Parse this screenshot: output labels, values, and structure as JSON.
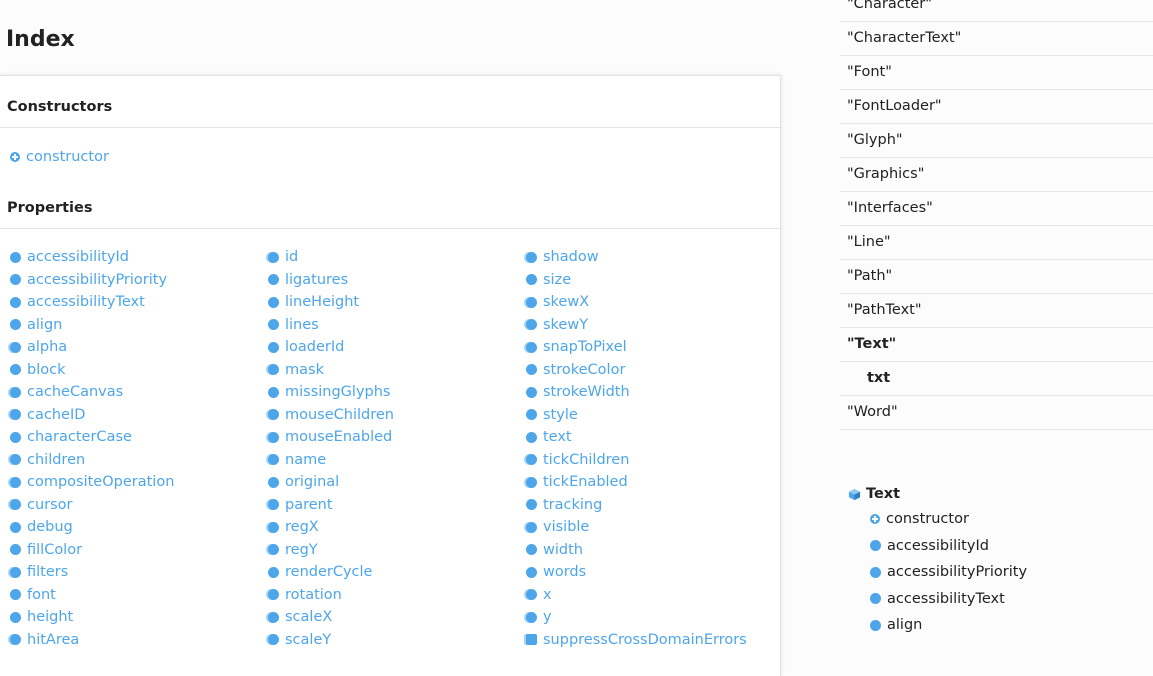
{
  "page_title": "Index",
  "sections": {
    "constructors_title": "Constructors",
    "properties_title": "Properties"
  },
  "constructor_link": "constructor",
  "properties": {
    "col1": [
      {
        "label": "accessibilityId",
        "icon": "property-icon"
      },
      {
        "label": "accessibilityPriority",
        "icon": "property-icon"
      },
      {
        "label": "accessibilityText",
        "icon": "property-icon"
      },
      {
        "label": "align",
        "icon": "property-icon"
      },
      {
        "label": "alpha",
        "icon": "inherited-property-icon"
      },
      {
        "label": "block",
        "icon": "property-icon"
      },
      {
        "label": "cacheCanvas",
        "icon": "inherited-property-icon"
      },
      {
        "label": "cacheID",
        "icon": "inherited-property-icon"
      },
      {
        "label": "characterCase",
        "icon": "property-icon"
      },
      {
        "label": "children",
        "icon": "inherited-property-icon"
      },
      {
        "label": "compositeOperation",
        "icon": "inherited-property-icon"
      },
      {
        "label": "cursor",
        "icon": "inherited-property-icon"
      },
      {
        "label": "debug",
        "icon": "property-icon"
      },
      {
        "label": "fillColor",
        "icon": "property-icon"
      },
      {
        "label": "filters",
        "icon": "inherited-property-icon"
      },
      {
        "label": "font",
        "icon": "property-icon"
      },
      {
        "label": "height",
        "icon": "property-icon"
      },
      {
        "label": "hitArea",
        "icon": "inherited-property-icon"
      }
    ],
    "col2": [
      {
        "label": "id",
        "icon": "inherited-property-icon"
      },
      {
        "label": "ligatures",
        "icon": "property-icon"
      },
      {
        "label": "lineHeight",
        "icon": "property-icon"
      },
      {
        "label": "lines",
        "icon": "property-icon"
      },
      {
        "label": "loaderId",
        "icon": "property-icon"
      },
      {
        "label": "mask",
        "icon": "inherited-property-icon"
      },
      {
        "label": "missingGlyphs",
        "icon": "property-icon"
      },
      {
        "label": "mouseChildren",
        "icon": "inherited-property-icon"
      },
      {
        "label": "mouseEnabled",
        "icon": "inherited-property-icon"
      },
      {
        "label": "name",
        "icon": "inherited-property-icon"
      },
      {
        "label": "original",
        "icon": "property-icon"
      },
      {
        "label": "parent",
        "icon": "inherited-property-icon"
      },
      {
        "label": "regX",
        "icon": "inherited-property-icon"
      },
      {
        "label": "regY",
        "icon": "inherited-property-icon"
      },
      {
        "label": "renderCycle",
        "icon": "property-icon"
      },
      {
        "label": "rotation",
        "icon": "inherited-property-icon"
      },
      {
        "label": "scaleX",
        "icon": "inherited-property-icon"
      },
      {
        "label": "scaleY",
        "icon": "inherited-property-icon"
      }
    ],
    "col3": [
      {
        "label": "shadow",
        "icon": "inherited-property-icon"
      },
      {
        "label": "size",
        "icon": "property-icon"
      },
      {
        "label": "skewX",
        "icon": "inherited-property-icon"
      },
      {
        "label": "skewY",
        "icon": "inherited-property-icon"
      },
      {
        "label": "snapToPixel",
        "icon": "inherited-property-icon"
      },
      {
        "label": "strokeColor",
        "icon": "property-icon"
      },
      {
        "label": "strokeWidth",
        "icon": "property-icon"
      },
      {
        "label": "style",
        "icon": "property-icon"
      },
      {
        "label": "text",
        "icon": "property-icon"
      },
      {
        "label": "tickChildren",
        "icon": "inherited-property-icon"
      },
      {
        "label": "tickEnabled",
        "icon": "inherited-property-icon"
      },
      {
        "label": "tracking",
        "icon": "property-icon"
      },
      {
        "label": "visible",
        "icon": "inherited-property-icon"
      },
      {
        "label": "width",
        "icon": "property-icon"
      },
      {
        "label": "words",
        "icon": "property-icon"
      },
      {
        "label": "x",
        "icon": "inherited-property-icon"
      },
      {
        "label": "y",
        "icon": "inherited-property-icon"
      },
      {
        "label": "suppressCrossDomainErrors",
        "icon": "static-property-icon"
      }
    ]
  },
  "module_nav": [
    {
      "label": "\"Character\"",
      "state": "normal"
    },
    {
      "label": "\"CharacterText\"",
      "state": "normal"
    },
    {
      "label": "\"Font\"",
      "state": "normal"
    },
    {
      "label": "\"FontLoader\"",
      "state": "normal"
    },
    {
      "label": "\"Glyph\"",
      "state": "normal"
    },
    {
      "label": "\"Graphics\"",
      "state": "normal"
    },
    {
      "label": "\"Interfaces\"",
      "state": "normal"
    },
    {
      "label": "\"Line\"",
      "state": "normal"
    },
    {
      "label": "\"Path\"",
      "state": "normal"
    },
    {
      "label": "\"PathText\"",
      "state": "normal"
    },
    {
      "label": "\"Text\"",
      "state": "active"
    },
    {
      "label": "txt",
      "state": "child"
    },
    {
      "label": "\"Word\"",
      "state": "normal"
    }
  ],
  "class_toc": {
    "title": "Text",
    "items": [
      {
        "label": "constructor",
        "icon": "constructor-icon"
      },
      {
        "label": "accessibilityId",
        "icon": "property-icon"
      },
      {
        "label": "accessibilityPriority",
        "icon": "property-icon"
      },
      {
        "label": "accessibilityText",
        "icon": "property-icon"
      },
      {
        "label": "align",
        "icon": "property-icon"
      }
    ]
  },
  "colors": {
    "link": "#4da6e9",
    "icon_light": "#a9d3f5",
    "text": "#222222",
    "divider": "#e6e6e6"
  }
}
